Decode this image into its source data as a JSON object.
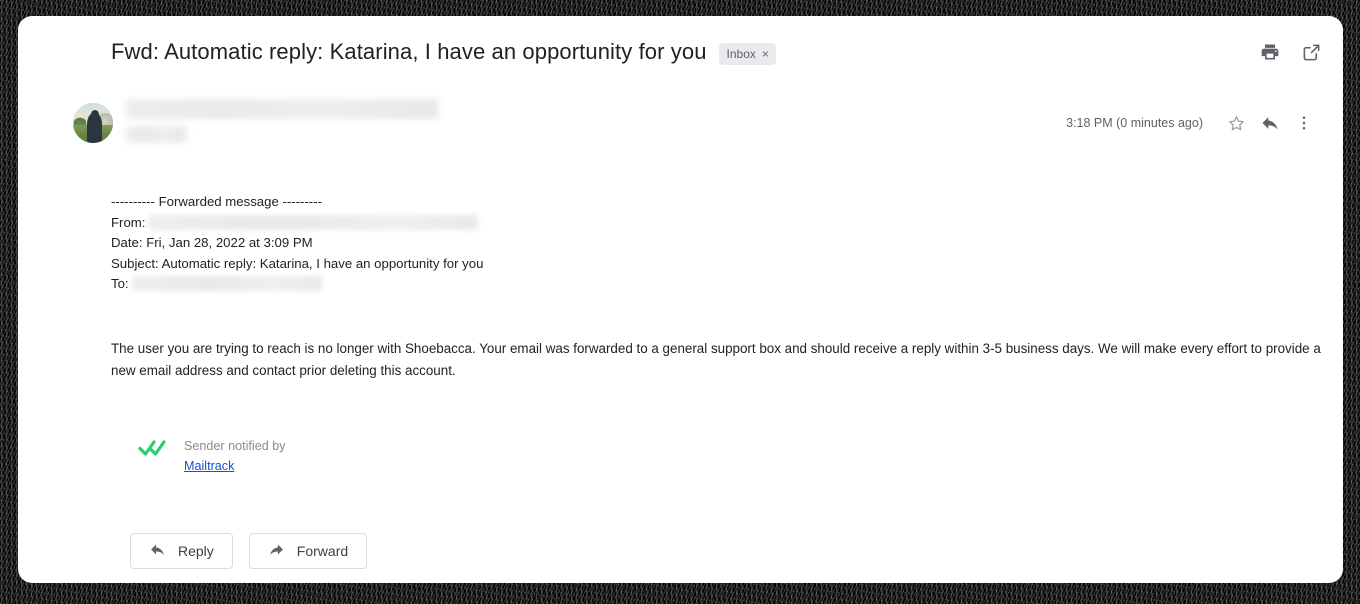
{
  "window": {
    "background_color": "#000000",
    "card_color": "#ffffff"
  },
  "header": {
    "subject": "Fwd: Automatic reply: Katarina, I have an opportunity for you",
    "label_chip": {
      "text": "Inbox",
      "remove_glyph": "×",
      "background_color": "#e8eaed",
      "text_color": "#5f6368"
    },
    "icons": [
      {
        "name": "print-icon",
        "title": "Print all"
      },
      {
        "name": "open-in-new-icon",
        "title": "Open in new window"
      }
    ]
  },
  "sender": {
    "name_redacted": true,
    "email_redacted": true,
    "avatar": "profile-photo-outdoor",
    "timestamp": "3:18 PM (0 minutes ago)",
    "icons": [
      {
        "name": "star-icon",
        "title": "Not starred"
      },
      {
        "name": "reply-icon",
        "title": "Reply"
      },
      {
        "name": "more-options-icon",
        "title": "More"
      }
    ]
  },
  "forwarded": {
    "divider": "---------- Forwarded message ---------",
    "from_label": "From:",
    "from_value_redacted": true,
    "date_label": "Date:",
    "date_value": "Fri, Jan 28, 2022 at 3:09 PM",
    "subject_label": "Subject:",
    "subject_value": "Automatic reply: Katarina, I have an opportunity for you",
    "to_label": "To:",
    "to_value_redacted": true
  },
  "message": {
    "body": "The user you are trying to reach is no longer with Shoebacca. Your email was forwarded to a general support box and should receive a reply within 3-5 business days. We will make every effort to provide a new email address and contact prior deleting this account."
  },
  "mailtrack": {
    "check_icon": "double-check-icon",
    "check_color": "#2ecc71",
    "notice": "Sender notified by",
    "link_text": "Mailtrack",
    "link_color": "#1155cc"
  },
  "actions": {
    "reply_label": "Reply",
    "forward_label": "Forward"
  }
}
